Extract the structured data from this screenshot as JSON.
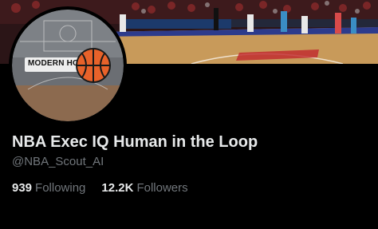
{
  "profile": {
    "display_name": "NBA Exec IQ Human in the Loop",
    "handle": "@NBA_Scout_AI",
    "avatar_text": "MODERN HOOPS"
  },
  "stats": {
    "following_count": "939",
    "following_label": "Following",
    "followers_count": "12.2K",
    "followers_label": "Followers"
  },
  "colors": {
    "background": "#000000",
    "primary_text": "#e7e9ea",
    "secondary_text": "#71767b",
    "banner_court": "#c89a5a",
    "basketball_orange": "#e8622a"
  },
  "icons": {
    "avatar_logo": "basketball-icon"
  }
}
